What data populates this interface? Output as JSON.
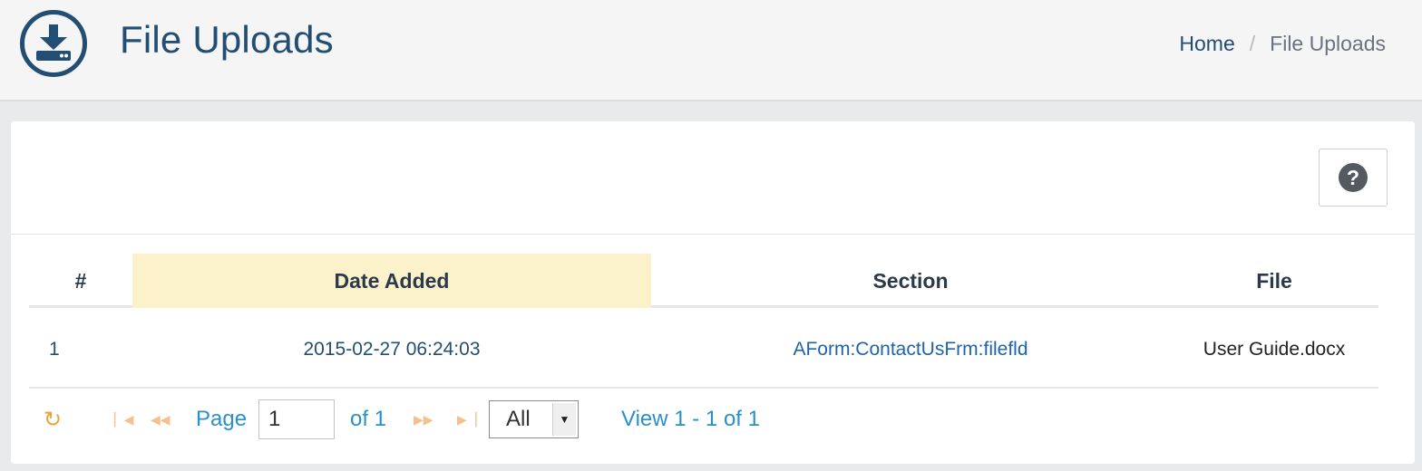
{
  "header": {
    "icon": "download-icon",
    "title": "File Uploads",
    "breadcrumb": {
      "home": "Home",
      "separator": "/",
      "current": "File Uploads"
    }
  },
  "toolbar": {
    "help_icon": "question-icon",
    "help_label": "?"
  },
  "table": {
    "columns": [
      "#",
      "Date Added",
      "Section",
      "File"
    ],
    "sorted_column": "Date Added",
    "rows": [
      {
        "num": "1",
        "date_added": "2015-02-27 06:24:03",
        "section": "AForm:ContactUsFrm:filefld",
        "file": "User Guide.docx"
      }
    ]
  },
  "pager": {
    "refresh_icon": "refresh-icon",
    "first_icon": "first-page-icon",
    "prev_icon": "prev-page-icon",
    "next_icon": "next-page-icon",
    "last_icon": "last-page-icon",
    "page_label": "Page",
    "page_value": "1",
    "of_label": "of 1",
    "rows_per_page": "All",
    "view_text": "View 1 - 1 of 1"
  },
  "colors": {
    "accent": "#234e74",
    "link": "#2a90c9",
    "sorted_header_bg": "#fbf2cc",
    "refresh": "#f0a030"
  }
}
